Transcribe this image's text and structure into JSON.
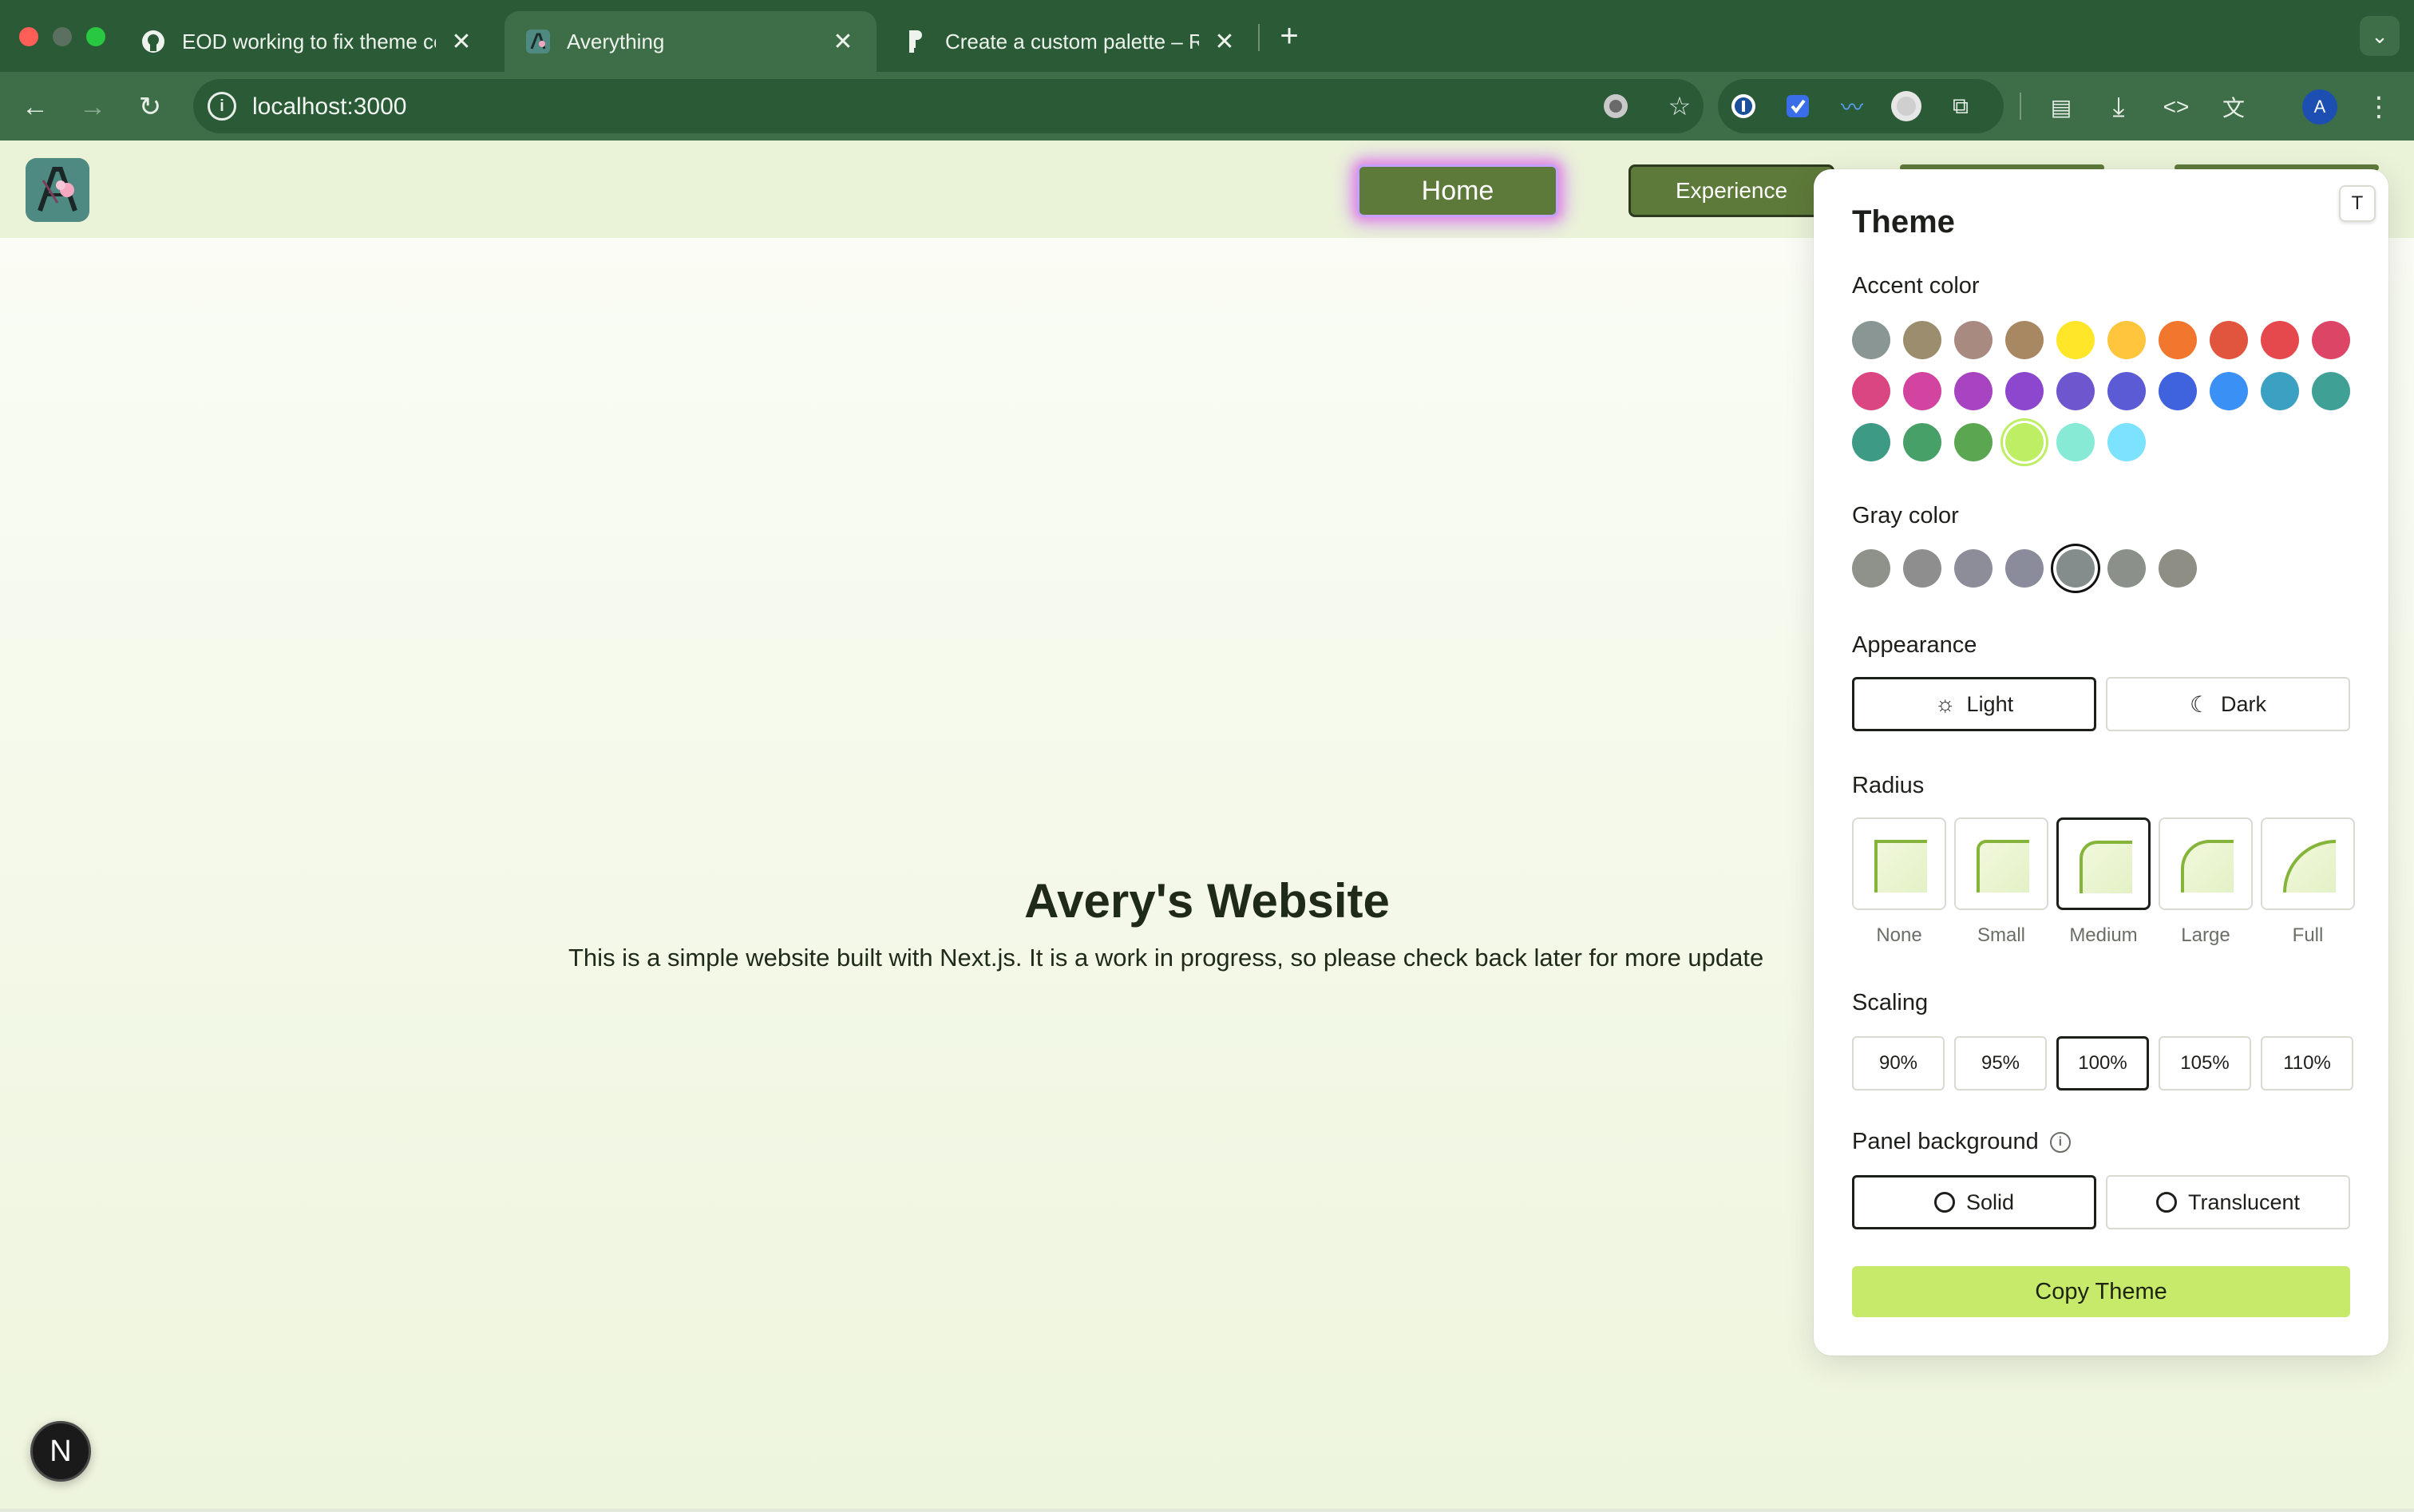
{
  "browser": {
    "tabs": [
      {
        "title": "EOD working to fix theme colo",
        "icon": "github-icon",
        "active": false
      },
      {
        "title": "Averything",
        "icon": "favicon-avery",
        "active": true
      },
      {
        "title": "Create a custom palette – Ra",
        "icon": "figma-icon",
        "active": false
      }
    ],
    "new_tab_label": "+",
    "address": "localhost:3000",
    "profile_initial": "A"
  },
  "site": {
    "nav": {
      "home_label": "Home",
      "experience_label": "Experience"
    },
    "hero": {
      "title": "Avery's Website",
      "subtitle": "This is a simple website built with Next.js. It is a work in progress, so please check back later for more update"
    },
    "dev_badge": "N"
  },
  "theme_panel": {
    "toggle_label": "T",
    "title": "Theme",
    "accent": {
      "label": "Accent color",
      "colors": [
        "#8a9693",
        "#9c8d6e",
        "#a88a80",
        "#a88863",
        "#ffe629",
        "#ffc53d",
        "#f1772e",
        "#e1553f",
        "#e5484d",
        "#dc4565",
        "#d94682",
        "#d244a0",
        "#a844c2",
        "#8d47cf",
        "#6e56cf",
        "#5b5bd6",
        "#3e63dd",
        "#3b90f5",
        "#3ca0c2",
        "#3fa095",
        "#3d9a84",
        "#47a068",
        "#5ba651",
        "#bdee63",
        "#86ead4",
        "#7ce2fe"
      ],
      "selected": "#bdee63"
    },
    "gray": {
      "label": "Gray color",
      "colors": [
        "#8f928a",
        "#8e8e8e",
        "#8d8d9a",
        "#8a8b9b",
        "#858c8c",
        "#8b908a",
        "#8e8e84"
      ],
      "selected": "#858c8c"
    },
    "appearance": {
      "label": "Appearance",
      "options": [
        {
          "label": "Light",
          "icon": "sun-icon",
          "selected": true
        },
        {
          "label": "Dark",
          "icon": "moon-icon",
          "selected": false
        }
      ]
    },
    "radius": {
      "label": "Radius",
      "options": [
        {
          "label": "None",
          "selected": false
        },
        {
          "label": "Small",
          "selected": false
        },
        {
          "label": "Medium",
          "selected": true
        },
        {
          "label": "Large",
          "selected": false
        },
        {
          "label": "Full",
          "selected": false
        }
      ]
    },
    "scaling": {
      "label": "Scaling",
      "options": [
        {
          "label": "90%",
          "selected": false
        },
        {
          "label": "95%",
          "selected": false
        },
        {
          "label": "100%",
          "selected": true
        },
        {
          "label": "105%",
          "selected": false
        },
        {
          "label": "110%",
          "selected": false
        }
      ]
    },
    "panel_background": {
      "label": "Panel background",
      "options": [
        {
          "label": "Solid",
          "selected": true
        },
        {
          "label": "Translucent",
          "selected": false
        }
      ]
    },
    "copy_button": "Copy Theme"
  }
}
